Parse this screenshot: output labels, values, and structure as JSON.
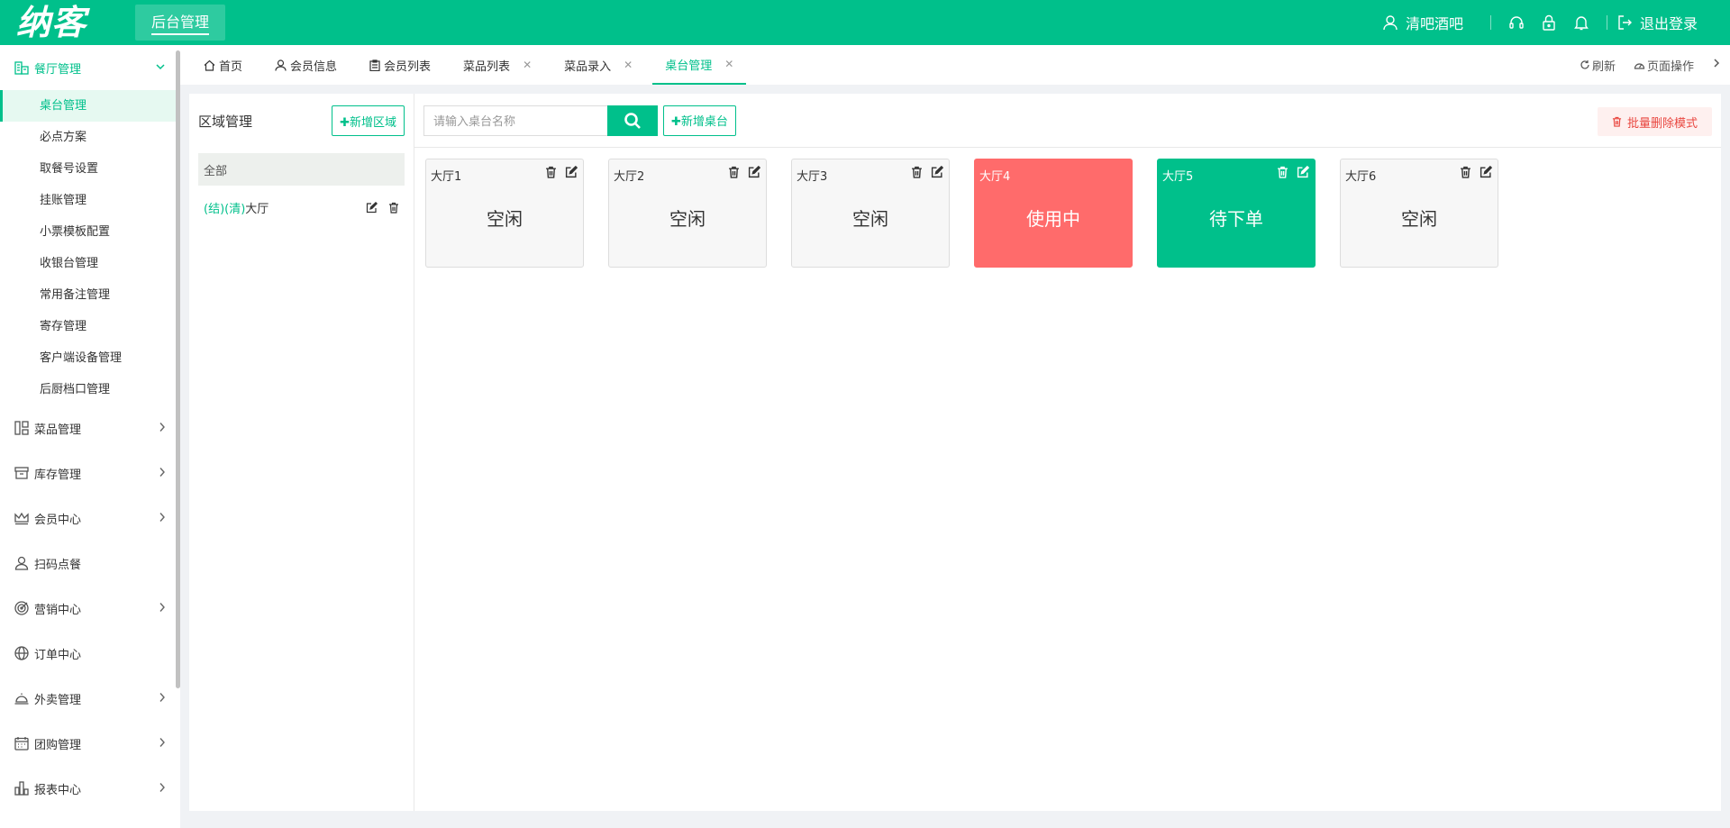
{
  "header": {
    "logo": "纳客",
    "system_tab": "后台管理",
    "user_name": "清吧酒吧",
    "logout": "退出登录"
  },
  "sidebar": {
    "open_group": "餐厅管理",
    "sub_items": [
      "桌台管理",
      "必点方案",
      "取餐号设置",
      "挂账管理",
      "小票模板配置",
      "收银台管理",
      "常用备注管理",
      "寄存管理",
      "客户端设备管理",
      "后厨档口管理"
    ],
    "groups": [
      {
        "label": "菜品管理",
        "icon": "dishes-icon"
      },
      {
        "label": "库存管理",
        "icon": "inventory-icon"
      },
      {
        "label": "会员中心",
        "icon": "crown-icon"
      },
      {
        "label": "扫码点餐",
        "icon": "user-icon"
      },
      {
        "label": "营销中心",
        "icon": "target-icon"
      },
      {
        "label": "订单中心",
        "icon": "globe-icon"
      },
      {
        "label": "外卖管理",
        "icon": "cloche-icon"
      },
      {
        "label": "团购管理",
        "icon": "calendar-icon"
      },
      {
        "label": "报表中心",
        "icon": "bar-chart-icon"
      }
    ]
  },
  "tabs": [
    {
      "label": "首页",
      "closable": false
    },
    {
      "label": "会员信息",
      "closable": false
    },
    {
      "label": "会员列表",
      "closable": false
    },
    {
      "label": "菜品列表",
      "closable": true
    },
    {
      "label": "菜品录入",
      "closable": true
    },
    {
      "label": "桌台管理",
      "closable": true
    }
  ],
  "tab_actions": {
    "refresh": "刷新",
    "page_ops": "页面操作"
  },
  "area": {
    "title": "区域管理",
    "add_button": "✚新增区域",
    "all_label": "全部",
    "items": [
      {
        "tags": "(结)(清)",
        "name": "大厅"
      }
    ]
  },
  "toolbar": {
    "search_placeholder": "请输入桌台名称",
    "add_table_button": "✚新增桌台",
    "batch_delete": "批量删除模式"
  },
  "tables": [
    {
      "name": "大厅1",
      "status": "空闲"
    },
    {
      "name": "大厅2",
      "status": "空闲"
    },
    {
      "name": "大厅3",
      "status": "空闲"
    },
    {
      "name": "大厅4",
      "status": "使用中"
    },
    {
      "name": "大厅5",
      "status": "待下单"
    },
    {
      "name": "大厅6",
      "status": "空闲"
    }
  ],
  "colors": {
    "brand": "#00c08b",
    "in_use": "#ff6b6b",
    "danger_text": "#e9463f"
  }
}
